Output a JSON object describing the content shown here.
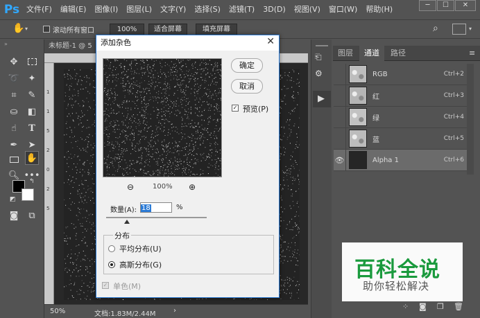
{
  "app": {
    "logo": "Ps"
  },
  "menus": [
    "文件(F)",
    "编辑(E)",
    "图像(I)",
    "图层(L)",
    "文字(Y)",
    "选择(S)",
    "滤镜(T)",
    "3D(D)",
    "视图(V)",
    "窗口(W)",
    "帮助(H)"
  ],
  "options": {
    "scroll_all": "滚动所有窗口",
    "zoom100": "100%",
    "fit_screen": "适合屏幕",
    "fill_screen": "填充屏幕"
  },
  "document": {
    "tab_title": "未标题-1 @ 5",
    "zoom": "50%",
    "doc_info": "文档:1.83M/2.44M"
  },
  "ruler_left": [
    "1",
    "1",
    "5",
    "2",
    "0",
    "2",
    "5"
  ],
  "panels": {
    "tabs": [
      "图层",
      "通道",
      "路径"
    ],
    "active_tab": "通道",
    "channels": [
      {
        "name": "RGB",
        "shortcut": "Ctrl+2",
        "eye": ""
      },
      {
        "name": "红",
        "shortcut": "Ctrl+3",
        "eye": ""
      },
      {
        "name": "绿",
        "shortcut": "Ctrl+4",
        "eye": ""
      },
      {
        "name": "蓝",
        "shortcut": "Ctrl+5",
        "eye": ""
      },
      {
        "name": "Alpha 1",
        "shortcut": "Ctrl+6",
        "eye": "👁"
      }
    ]
  },
  "dialog": {
    "title": "添加杂色",
    "ok": "确定",
    "cancel": "取消",
    "preview_label": "预览(P)",
    "zoom_level": "100%",
    "amount_label": "数量(A):",
    "amount_value": "18",
    "amount_unit": "%",
    "distribution_group": "分布",
    "uniform_label": "平均分布(U)",
    "gaussian_label": "高斯分布(G)",
    "mono_label": "单色(M)",
    "selected_distribution": "gaussian"
  },
  "watermark": {
    "title": "百科全说",
    "subtitle": "助你轻松解决"
  },
  "colors": {
    "accent": "#31a8ff",
    "dialog_border": "#2b7bd6",
    "watermark_green": "#1a9a3d"
  }
}
